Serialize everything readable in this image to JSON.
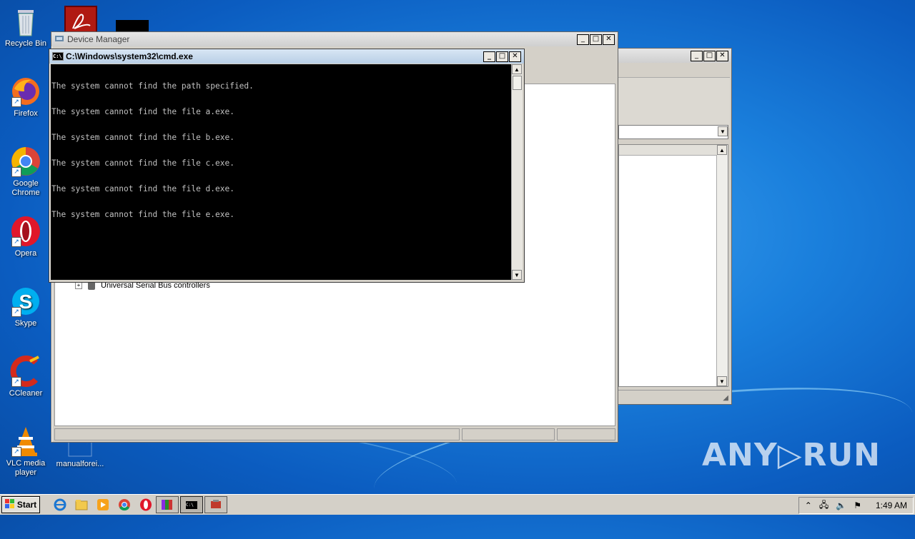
{
  "desktop": {
    "icons": [
      {
        "label": "Recycle Bin",
        "icon": "recycle-bin-icon"
      },
      {
        "label": "Firefox",
        "icon": "firefox-icon"
      },
      {
        "label": "Google Chrome",
        "icon": "chrome-icon"
      },
      {
        "label": "Opera",
        "icon": "opera-icon"
      },
      {
        "label": "Skype",
        "icon": "skype-icon"
      },
      {
        "label": "CCleaner",
        "icon": "ccleaner-icon"
      },
      {
        "label": "VLC media player",
        "icon": "vlc-icon"
      },
      {
        "label": "manualforei...",
        "icon": "document-icon"
      }
    ]
  },
  "device_manager": {
    "title": "Device Manager",
    "tree_item": "Universal Serial Bus controllers"
  },
  "cmd": {
    "title": "C:\\Windows\\system32\\cmd.exe",
    "lines": [
      "The system cannot find the path specified.",
      "The system cannot find the file a.exe.",
      "The system cannot find the file b.exe.",
      "The system cannot find the file c.exe.",
      "The system cannot find the file d.exe.",
      "The system cannot find the file e.exe."
    ]
  },
  "taskbar": {
    "start_label": "Start",
    "clock": "1:49 AM"
  },
  "watermark": "ANY▷RUN"
}
